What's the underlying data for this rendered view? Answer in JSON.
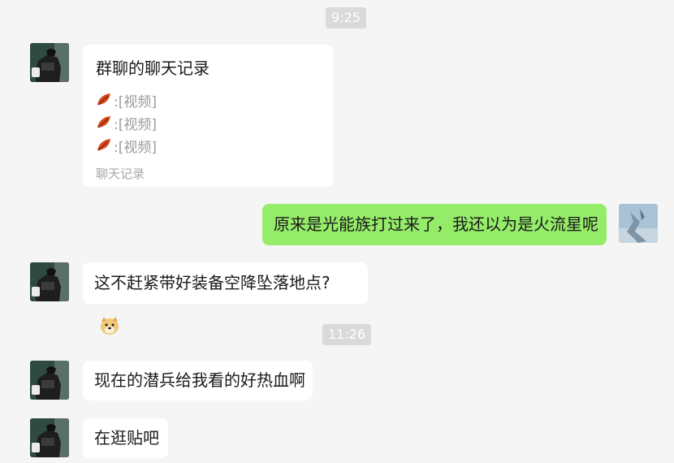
{
  "timestamps": [
    "9:25",
    "11:26"
  ],
  "forward_card": {
    "title": "群聊的聊天记录",
    "items": [
      ":[视频]",
      ":[视频]",
      ":[视频]"
    ],
    "footer": "聊天记录"
  },
  "messages": [
    {
      "sender": "self",
      "text": "原来是光能族打过来了，我还以为是火流星呢"
    },
    {
      "sender": "other",
      "text": "这不赶紧带好装备空降坠落地点?",
      "emoji": "doge-emoji"
    },
    {
      "sender": "other",
      "text": "现在的潜兵给我看的好热血啊"
    },
    {
      "sender": "other",
      "text": "在逛贴吧"
    }
  ],
  "colors": {
    "background": "#f5f5f5",
    "self_bubble": "#95ec69",
    "other_bubble": "#ffffff",
    "timestamp_bg": "#dadada"
  }
}
